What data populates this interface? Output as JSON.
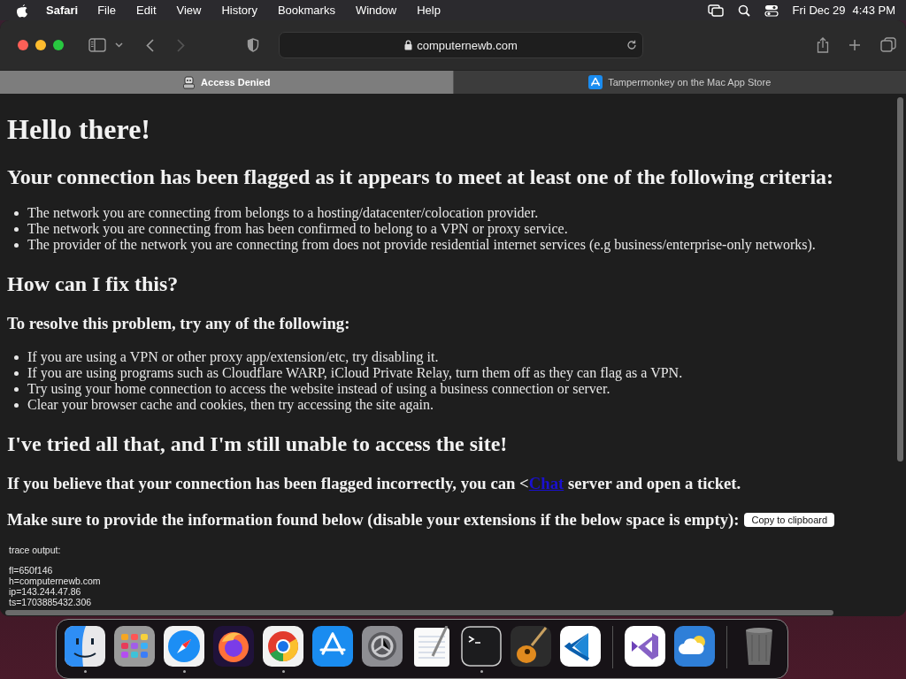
{
  "menu_bar": {
    "app": "Safari",
    "menus": [
      "File",
      "Edit",
      "View",
      "History",
      "Bookmarks",
      "Window",
      "Help"
    ],
    "date": "Fri Dec 29",
    "time": "4:43 PM"
  },
  "toolbar": {
    "address": "computernewb.com",
    "back_disabled": false,
    "forward_disabled": true
  },
  "tabs": [
    {
      "label": "Access Denied",
      "selected": true,
      "kind": "robot"
    },
    {
      "label": "Tampermonkey on the Mac App Store",
      "selected": false,
      "kind": "appstore"
    }
  ],
  "page": {
    "blocks": [
      {
        "kind": "h1",
        "text": "Hello there!"
      },
      {
        "kind": "h2",
        "text": "Your connection has been flagged as it appears to meet at least one of the following criteria:"
      },
      {
        "kind": "list",
        "items": [
          "The network you are connecting from belongs to a hosting/datacenter/colocation provider.",
          "The network you are connecting from has been confirmed to belong to a VPN or proxy service.",
          "The provider of the network you are connecting from does not provide residential internet services (e.g business/enterprise-only networks)."
        ]
      },
      {
        "kind": "h2",
        "text": "How can I fix this?"
      },
      {
        "kind": "h3",
        "text": "To resolve this problem, try any of the following:"
      },
      {
        "kind": "list",
        "items": [
          "If you are using a VPN or other proxy app/extension/etc, try disabling it.",
          "If you are using programs such as Cloudflare WARP, iCloud Private Relay, turn them off as they can flag as a VPN.",
          "Try using your home connection to access the website instead of using a business connection or server.",
          "Clear your browser cache and cookies, then try accessing the site again."
        ]
      },
      {
        "kind": "h2",
        "text": "I've tried all that, and I'm still unable to access the site!"
      },
      {
        "kind": "link_h3",
        "before": "If you believe that your connection has been flagged incorrectly, you can <",
        "link": "Chat",
        "after": " server and open a ticket."
      },
      {
        "kind": "button_h3",
        "text": "Make sure to provide the information found below (disable your extensions if the below space is empty):",
        "button": "Copy to clipboard"
      },
      {
        "kind": "trace",
        "title": "trace output:",
        "lines": [
          "fl=650f146",
          "h=computernewb.com",
          "ip=143.244.47.86",
          "ts=1703885432.306"
        ]
      }
    ]
  },
  "dock": {
    "items": [
      {
        "kind": "finder",
        "running": true
      },
      {
        "kind": "launchpad",
        "running": false
      },
      {
        "kind": "safari",
        "running": true
      },
      {
        "kind": "firefox",
        "running": false
      },
      {
        "kind": "chrome",
        "running": true
      },
      {
        "kind": "appstore",
        "running": false
      },
      {
        "kind": "settings",
        "running": false
      },
      {
        "kind": "textedit",
        "running": false
      },
      {
        "kind": "terminal",
        "running": true
      },
      {
        "kind": "guitar",
        "running": false
      },
      {
        "kind": "vscode",
        "running": false
      },
      {
        "kind": "separator"
      },
      {
        "kind": "vstudio",
        "running": false
      },
      {
        "kind": "weather",
        "running": false
      },
      {
        "kind": "separator"
      },
      {
        "kind": "trash",
        "running": false
      }
    ]
  }
}
